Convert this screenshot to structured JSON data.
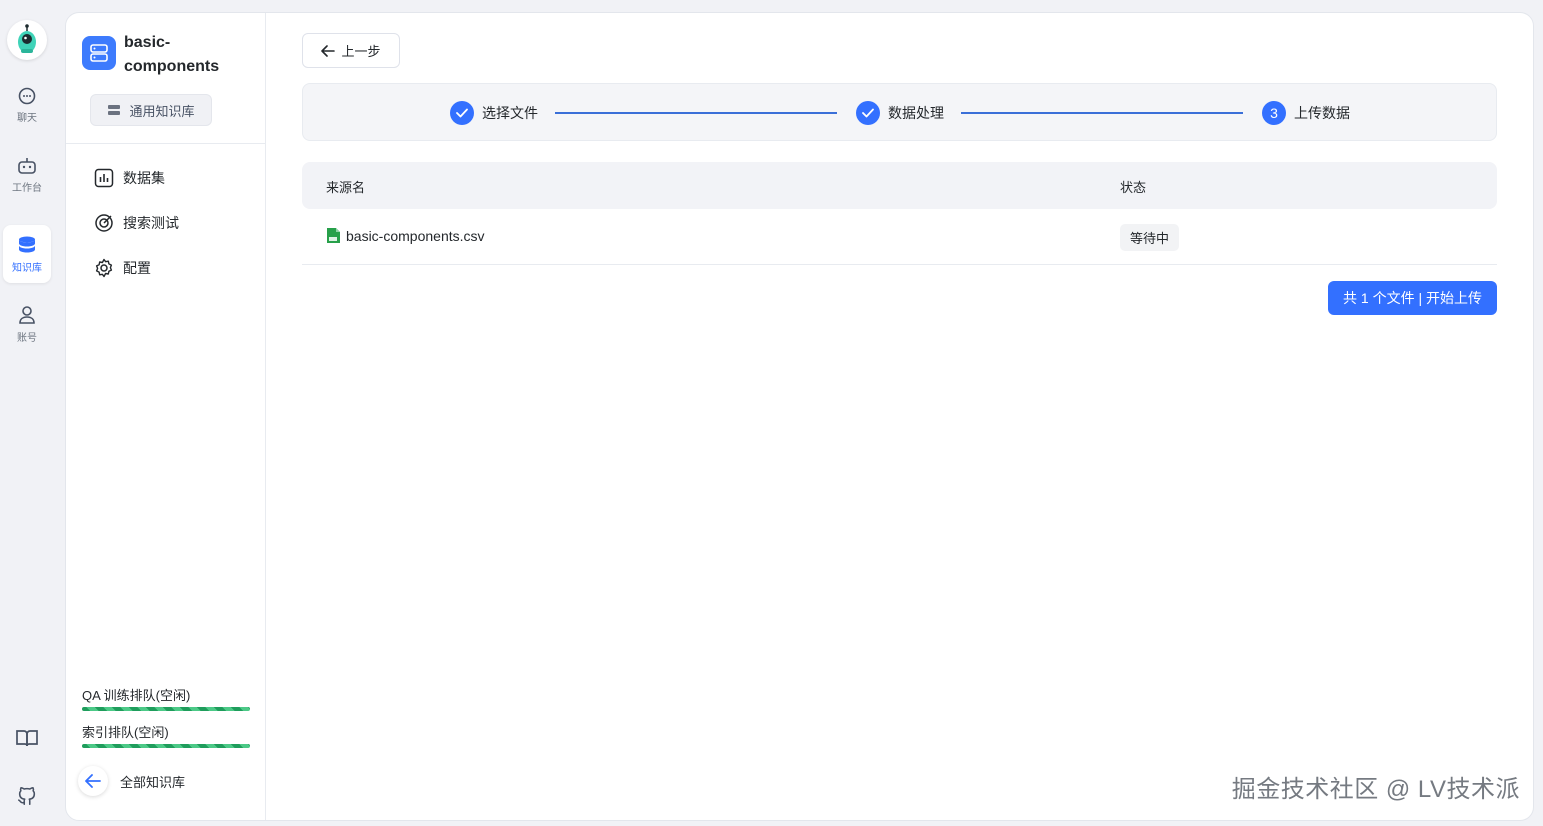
{
  "rail": {
    "items": [
      {
        "label": "聊天",
        "icon": "chat-bubble-icon"
      },
      {
        "label": "工作台",
        "icon": "robot-icon"
      },
      {
        "label": "知识库",
        "icon": "database-icon",
        "active": true
      },
      {
        "label": "账号",
        "icon": "user-icon"
      }
    ],
    "bottom": [
      "book-icon",
      "github-icon"
    ]
  },
  "kb": {
    "name": "basic-components",
    "type_label": "通用知识库"
  },
  "sidebar": {
    "menu": [
      {
        "label": "数据集",
        "icon": "chart-icon"
      },
      {
        "label": "搜索测试",
        "icon": "target-icon"
      },
      {
        "label": "配置",
        "icon": "gear-icon"
      }
    ],
    "queues": [
      {
        "label": "QA 训练排队(空闲)"
      },
      {
        "label": "索引排队(空闲)"
      }
    ],
    "back_all_label": "全部知识库"
  },
  "toolbar": {
    "prev_label": "上一步"
  },
  "steps": [
    {
      "label": "选择文件",
      "state": "done"
    },
    {
      "label": "数据处理",
      "state": "done"
    },
    {
      "label": "上传数据",
      "state": "current",
      "number": "3"
    }
  ],
  "table": {
    "headers": {
      "source": "来源名",
      "status": "状态"
    },
    "rows": [
      {
        "file": "basic-components.csv",
        "status": "等待中"
      }
    ]
  },
  "upload_button": "共 1 个文件 | 开始上传",
  "watermark": "掘金技术社区 @ LV技术派",
  "colors": {
    "primary": "#3370ff",
    "queue_bar": "#1f9d5c",
    "csv_icon": "#27a04a"
  }
}
